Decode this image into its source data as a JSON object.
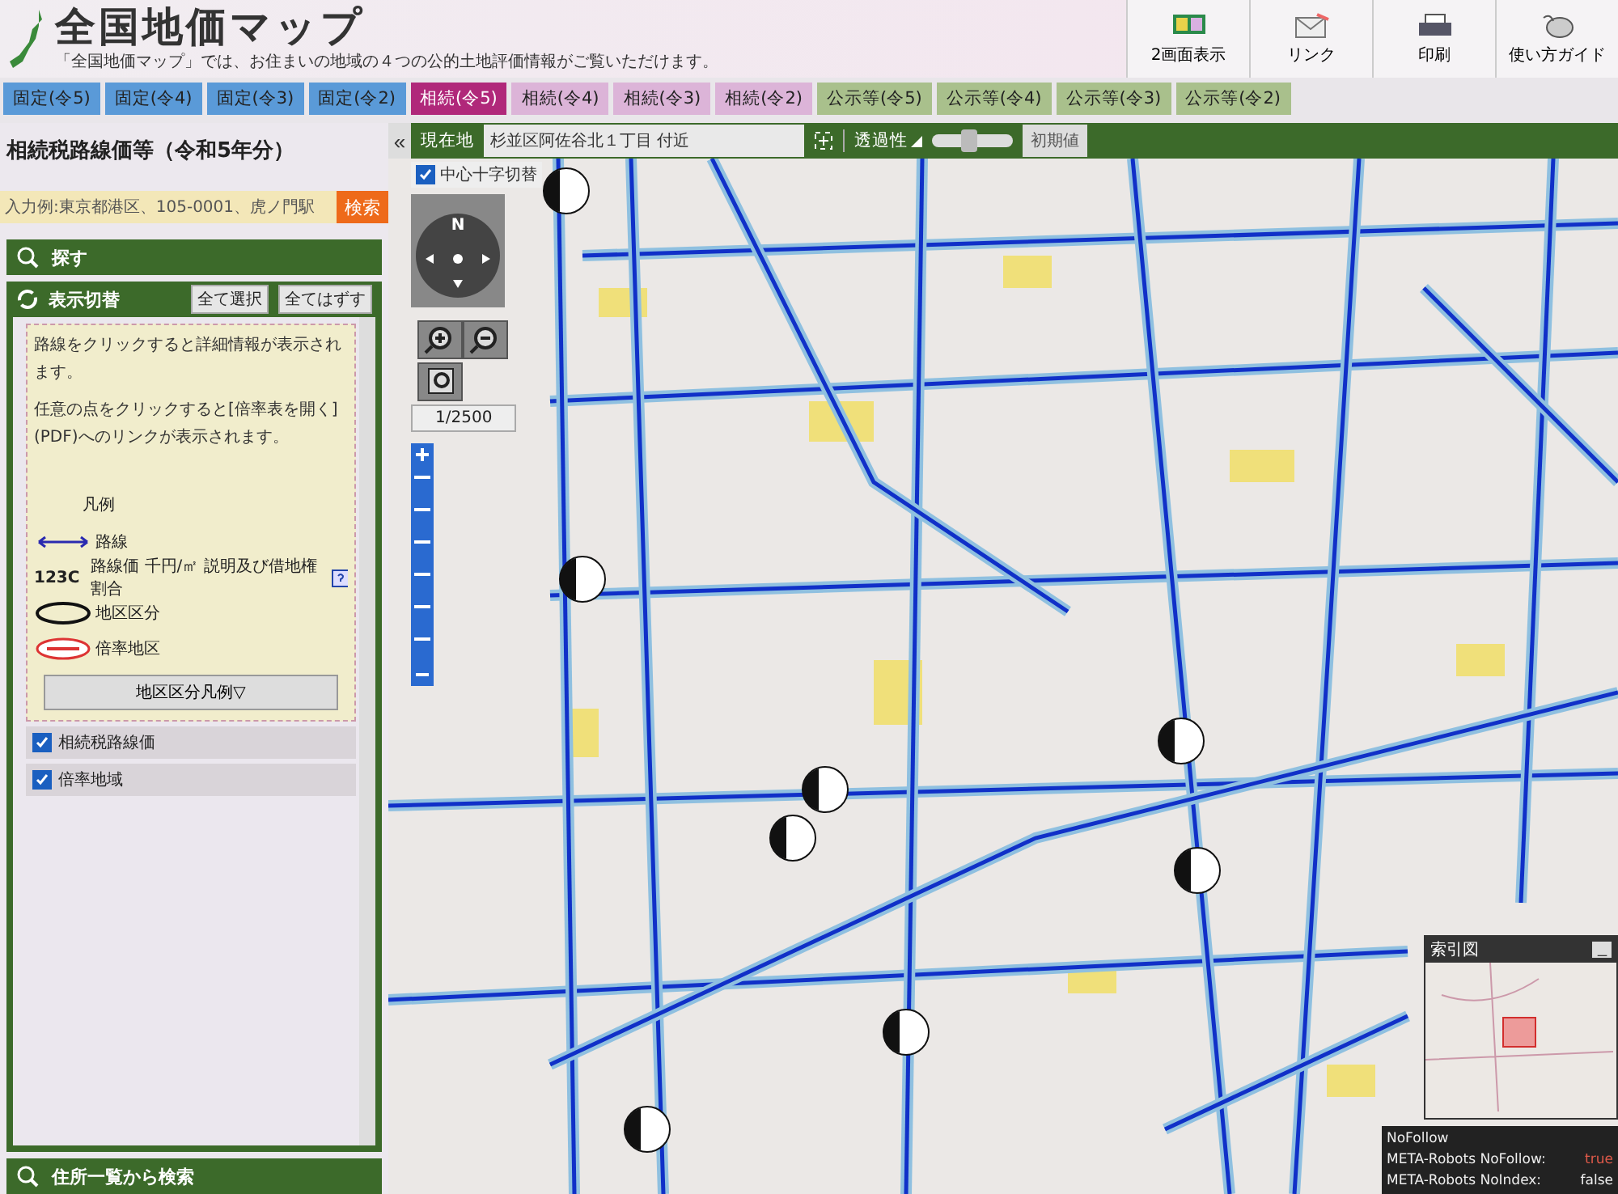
{
  "header": {
    "title": "全国地価マップ",
    "subtitle": "「全国地価マップ」では、お住まいの地域の４つの公的土地評価情報がご覧いただけます。",
    "tools": [
      {
        "kind": "split",
        "label": "2画面表示"
      },
      {
        "kind": "link",
        "label": "リンク"
      },
      {
        "kind": "print",
        "label": "印刷"
      },
      {
        "kind": "guide",
        "label": "使い方ガイド"
      }
    ]
  },
  "tabs": [
    {
      "label": "固定(令5)",
      "kind": "fixed",
      "selected": false
    },
    {
      "label": "固定(令4)",
      "kind": "fixed",
      "selected": false
    },
    {
      "label": "固定(令3)",
      "kind": "fixed",
      "selected": false
    },
    {
      "label": "固定(令2)",
      "kind": "fixed",
      "selected": false
    },
    {
      "label": "相続(令5)",
      "kind": "inherit",
      "selected": true
    },
    {
      "label": "相続(令4)",
      "kind": "inherit",
      "selected": false
    },
    {
      "label": "相続(令3)",
      "kind": "inherit",
      "selected": false
    },
    {
      "label": "相続(令2)",
      "kind": "inherit",
      "selected": false
    },
    {
      "label": "公示等(令5)",
      "kind": "public",
      "selected": false
    },
    {
      "label": "公示等(令4)",
      "kind": "public",
      "selected": false
    },
    {
      "label": "公示等(令3)",
      "kind": "public",
      "selected": false
    },
    {
      "label": "公示等(令2)",
      "kind": "public",
      "selected": false
    }
  ],
  "panel": {
    "heading": "相続税路線価等（令和5年分）",
    "search": {
      "placeholder": "入力例:東京都港区、105-0001、虎ノ門駅",
      "button": "検索"
    },
    "find_label": "探す",
    "display": {
      "label": "表示切替",
      "buttons": [
        "全て選択",
        "全てはずす"
      ],
      "notes": [
        "路線をクリックすると詳細情報が表示されます。",
        "任意の点をクリックすると[倍率表を開く](PDF)へのリンクが表示されます。"
      ],
      "legend_title": "凡例",
      "legend": [
        {
          "kind": "arrow",
          "label": "路線"
        },
        {
          "kind": "value",
          "symbol": "123C",
          "label": "路線価 千円/㎡ 説明及び借地権割合"
        },
        {
          "kind": "ellipse",
          "label": "地区区分"
        },
        {
          "kind": "ratio",
          "label": "倍率地区"
        }
      ],
      "legend_button": "地区区分凡例▽",
      "layers": [
        {
          "label": "相続税路線価",
          "checked": true
        },
        {
          "label": "倍率地域",
          "checked": true
        }
      ]
    },
    "address_label": "住所一覧から検索"
  },
  "map": {
    "collapse": "«",
    "location_label": "現在地",
    "location": "杉並区阿佐谷北１丁目 付近",
    "opacity_label": "透過性",
    "opacity": {
      "level": 0.45
    },
    "reset_button": "初期値",
    "crosshair": {
      "label": "中心十字切替",
      "checked": true
    },
    "compass": "N",
    "scale": "1/2500",
    "index_map": {
      "title": "索引図",
      "minimize": "_"
    },
    "seo_panel": {
      "title": "NoFollow",
      "rows": [
        {
          "label": "META-Robots NoFollow:",
          "value": "true",
          "alert": true
        },
        {
          "label": "META-Robots NoIndex:",
          "value": "false",
          "alert": false
        }
      ]
    }
  }
}
